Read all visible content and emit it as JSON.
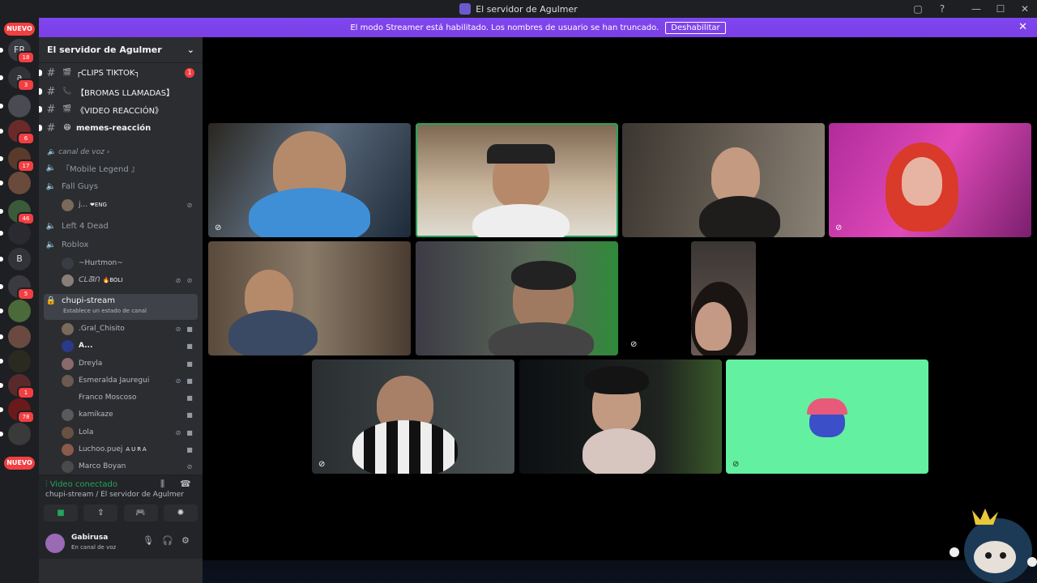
{
  "window": {
    "title": "El servidor de Agulmer",
    "controls": [
      "▢",
      "?",
      "—",
      "☐",
      "✕"
    ]
  },
  "banner": {
    "text": "El modo Streamer está habilitado. Los nombres de usuario se han truncado.",
    "button": "Deshabilitar",
    "close": "✕"
  },
  "guilds": {
    "new_top": "NUEVO",
    "new_bottom": "NUEVO",
    "items": [
      {
        "label": "FR",
        "badge": "18"
      },
      {
        "label": "a",
        "badge": "3"
      },
      {
        "label": "",
        "badge": ""
      },
      {
        "label": "",
        "badge": "6"
      },
      {
        "label": "",
        "badge": "17"
      },
      {
        "label": "",
        "badge": ""
      },
      {
        "label": "",
        "badge": "46"
      },
      {
        "label": "",
        "badge": ""
      },
      {
        "label": "B",
        "badge": ""
      },
      {
        "label": "",
        "badge": "5"
      },
      {
        "label": "",
        "badge": ""
      },
      {
        "label": "",
        "badge": ""
      },
      {
        "label": "",
        "badge": ""
      },
      {
        "label": "",
        "badge": "1"
      },
      {
        "label": "",
        "badge": "78"
      },
      {
        "label": "",
        "badge": ""
      }
    ]
  },
  "server": {
    "name": "El servidor de Agulmer",
    "chevron": "⌄"
  },
  "text_channels": [
    {
      "name": "┌CLIPS TIKTOK┐",
      "emoji": "🎬",
      "unread": "1"
    },
    {
      "name": "【BROMAS LLAMADAS】",
      "emoji": "📞",
      "unread": ""
    },
    {
      "name": "《VIDEO REACCIÓN》",
      "emoji": "🎬",
      "unread": ""
    },
    {
      "name": "memes-reacción",
      "emoji": "😆",
      "unread": ""
    }
  ],
  "voice_category": "canal de voz",
  "voice_channels": {
    "mobile_legend": "『Mobile Legend 』",
    "fall_guys": "Fall Guys",
    "fall_guys_users": [
      {
        "name": "j...",
        "tag": "❤ENG"
      }
    ],
    "left4dead": "Left 4 Dead",
    "roblox": "Roblox",
    "roblox_users": [
      {
        "name": "~Hurtmon~",
        "tag": ""
      },
      {
        "name": "ᑕᒪᘔIᑎ",
        "tag": "🔥BOLI"
      }
    ],
    "chupi": "chupi-stream",
    "chupi_status": "Establece un estado de canal",
    "chupi_users": [
      {
        "name": ".Gral_Chisito",
        "tag": ""
      },
      {
        "name": "A...",
        "tag": ""
      },
      {
        "name": "Dreyla",
        "tag": ""
      },
      {
        "name": "Esmeralda Jauregui",
        "tag": ""
      },
      {
        "name": "Franco Moscoso",
        "tag": ""
      },
      {
        "name": "kamikaze",
        "tag": ""
      },
      {
        "name": "Lola",
        "tag": ""
      },
      {
        "name": "Luchoo.puej",
        "tag": "AURA"
      },
      {
        "name": "Marco Boyan",
        "tag": ""
      }
    ]
  },
  "voice_panel": {
    "status": "Video conectado",
    "location": "chupi-stream / El servidor de Agulmer",
    "actions": [
      "■",
      "⇪",
      "🎮",
      "✺"
    ]
  },
  "user_panel": {
    "name": "Gabirusa",
    "status": "En canal de voz"
  },
  "colors": {
    "accent": "#5865f2",
    "banner": "#7b3fe4",
    "online": "#23a55a",
    "danger": "#f23f42",
    "sidebar": "#2b2d31",
    "guildbar": "#1e1f22"
  }
}
